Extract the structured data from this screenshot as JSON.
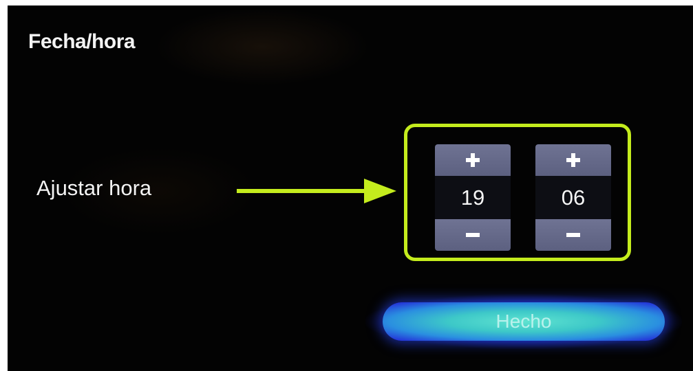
{
  "header": {
    "title": "Fecha/hora"
  },
  "setting": {
    "label": "Ajustar hora"
  },
  "time_picker": {
    "hour": {
      "value": "19",
      "increment_glyph": "+",
      "decrement_glyph": "−"
    },
    "minute": {
      "value": "06",
      "increment_glyph": "+",
      "decrement_glyph": "−"
    },
    "highlight_color": "#c4ec1d"
  },
  "actions": {
    "done_label": "Hecho"
  },
  "icons": {
    "arrow": "arrow-right-icon",
    "increment": "plus-icon",
    "decrement": "minus-icon"
  },
  "colors": {
    "background": "#030303",
    "spinner_button": "#666a8a",
    "done_button": "#3dc8c8",
    "done_glow": "#2438d8"
  }
}
